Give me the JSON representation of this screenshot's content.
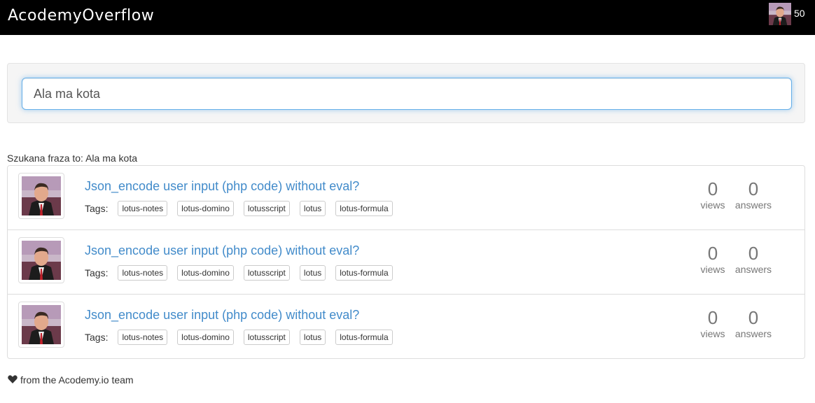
{
  "navbar": {
    "brand": "AcodemyOverflow",
    "reputation": "50"
  },
  "search": {
    "value": "Ala ma kota",
    "phrase_label": "Szukana fraza to:",
    "phrase_value": "Ala ma kota"
  },
  "questions": [
    {
      "title": "Json_encode user input (php code) without eval?",
      "tags_label": "Tags:",
      "tags": [
        "lotus-notes",
        "lotus-domino",
        "lotusscript",
        "lotus",
        "lotus-formula"
      ],
      "views": "0",
      "views_label": "views",
      "answers": "0",
      "answers_label": "answers"
    },
    {
      "title": "Json_encode user input (php code) without eval?",
      "tags_label": "Tags:",
      "tags": [
        "lotus-notes",
        "lotus-domino",
        "lotusscript",
        "lotus",
        "lotus-formula"
      ],
      "views": "0",
      "views_label": "views",
      "answers": "0",
      "answers_label": "answers"
    },
    {
      "title": "Json_encode user input (php code) without eval?",
      "tags_label": "Tags:",
      "tags": [
        "lotus-notes",
        "lotus-domino",
        "lotusscript",
        "lotus",
        "lotus-formula"
      ],
      "views": "0",
      "views_label": "views",
      "answers": "0",
      "answers_label": "answers"
    }
  ],
  "footer": {
    "text": "from the Acodemy.io team",
    "icon": "heart-icon"
  },
  "colors": {
    "navbar": "#000000",
    "link": "#428bca",
    "stat": "#777777"
  }
}
